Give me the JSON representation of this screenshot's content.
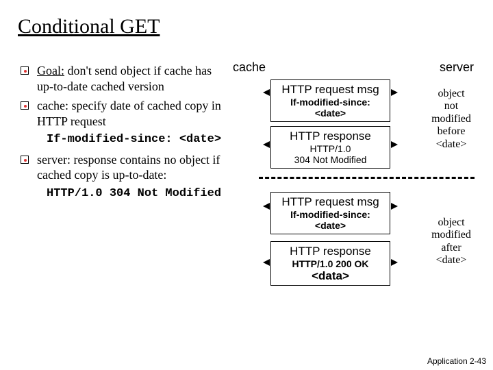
{
  "title": "Conditional GET",
  "bullets": [
    {
      "pre": "Goal:",
      "text": " don't send object if cache has up-to-date cached version",
      "sub": ""
    },
    {
      "pre": "",
      "text": "cache: specify date of cached copy in HTTP request",
      "sub": "If-modified-since: <date>"
    },
    {
      "pre": "",
      "text": "server: response contains no object if cached copy is up-to-date:",
      "sub": "HTTP/1.0 304 Not Modified"
    }
  ],
  "diagram": {
    "cache_label": "cache",
    "server_label": "server",
    "box1": {
      "l1": "HTTP request msg",
      "l2": "If-modified-since: <date>"
    },
    "box2": {
      "l1": "HTTP response",
      "l2": "HTTP/1.0",
      "l3": "304 Not Modified"
    },
    "box3": {
      "l1": "HTTP request msg",
      "l2": "If-modified-since: <date>"
    },
    "box4": {
      "l1": "HTTP response",
      "l2": "HTTP/1.0 200 OK",
      "l3": "<data>"
    },
    "note1": "object\nnot\nmodified\nbefore\n<date>",
    "note2": "object\nmodified\nafter\n<date>"
  },
  "footer": "Application  2-43"
}
